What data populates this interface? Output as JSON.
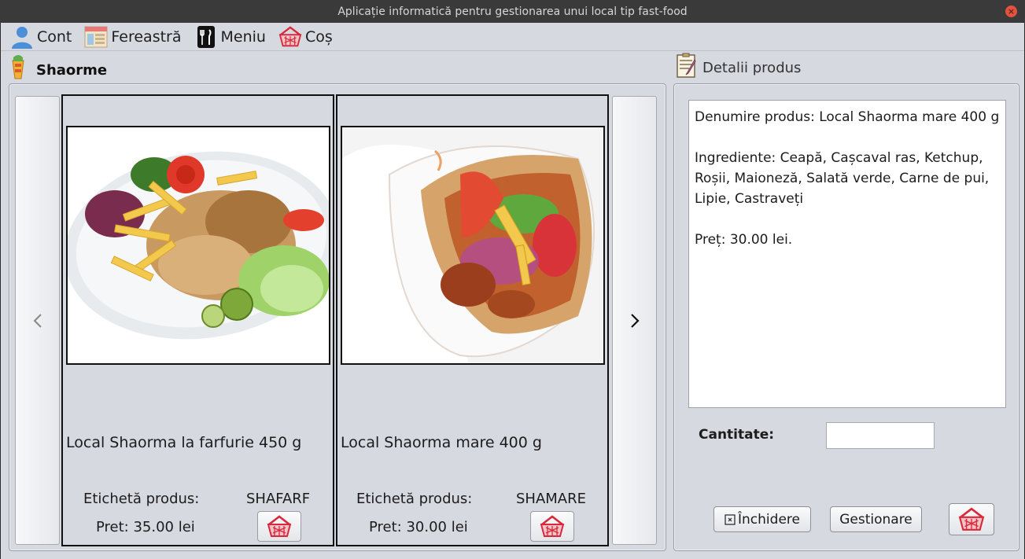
{
  "window": {
    "title": "Aplicație informatică pentru gestionarea unui local tip fast-food"
  },
  "menu": [
    {
      "label": "Cont",
      "icon": "user-icon"
    },
    {
      "label": "Fereastră",
      "icon": "window-icon"
    },
    {
      "label": "Meniu",
      "icon": "cutlery-icon"
    },
    {
      "label": "Coș",
      "icon": "basket-icon"
    }
  ],
  "category": {
    "title": "Shaorme",
    "icon": "shaorma-icon"
  },
  "details_section": {
    "title": "Detalii produs",
    "icon": "notepad-icon"
  },
  "products": [
    {
      "name": "Local Shaorma la farfurie 450 g",
      "tag_label": "Etichetă produs:",
      "tag": "SHAFARF",
      "price": "Pret: 35.00 lei"
    },
    {
      "name": "Local Shaorma mare 400 g",
      "tag_label": "Etichetă produs:",
      "tag": "SHAMARE",
      "price": "Pret: 30.00 lei"
    }
  ],
  "details": {
    "name_line": "Denumire produs: Local Shaorma mare 400 g",
    "ingredients_line": "Ingrediente: Ceapă, Cașcaval ras, Ketchup, Roșii, Maioneză, Salată verde, Carne de pui, Lipie, Castraveți",
    "price_line": "Preț: 30.00 lei."
  },
  "quantity": {
    "label": "Cantitate:",
    "value": ""
  },
  "buttons": {
    "close": "Închidere",
    "manage": "Gestionare"
  },
  "colors": {
    "accent_red": "#d8283a",
    "panel_bg": "#d7d9e0"
  }
}
